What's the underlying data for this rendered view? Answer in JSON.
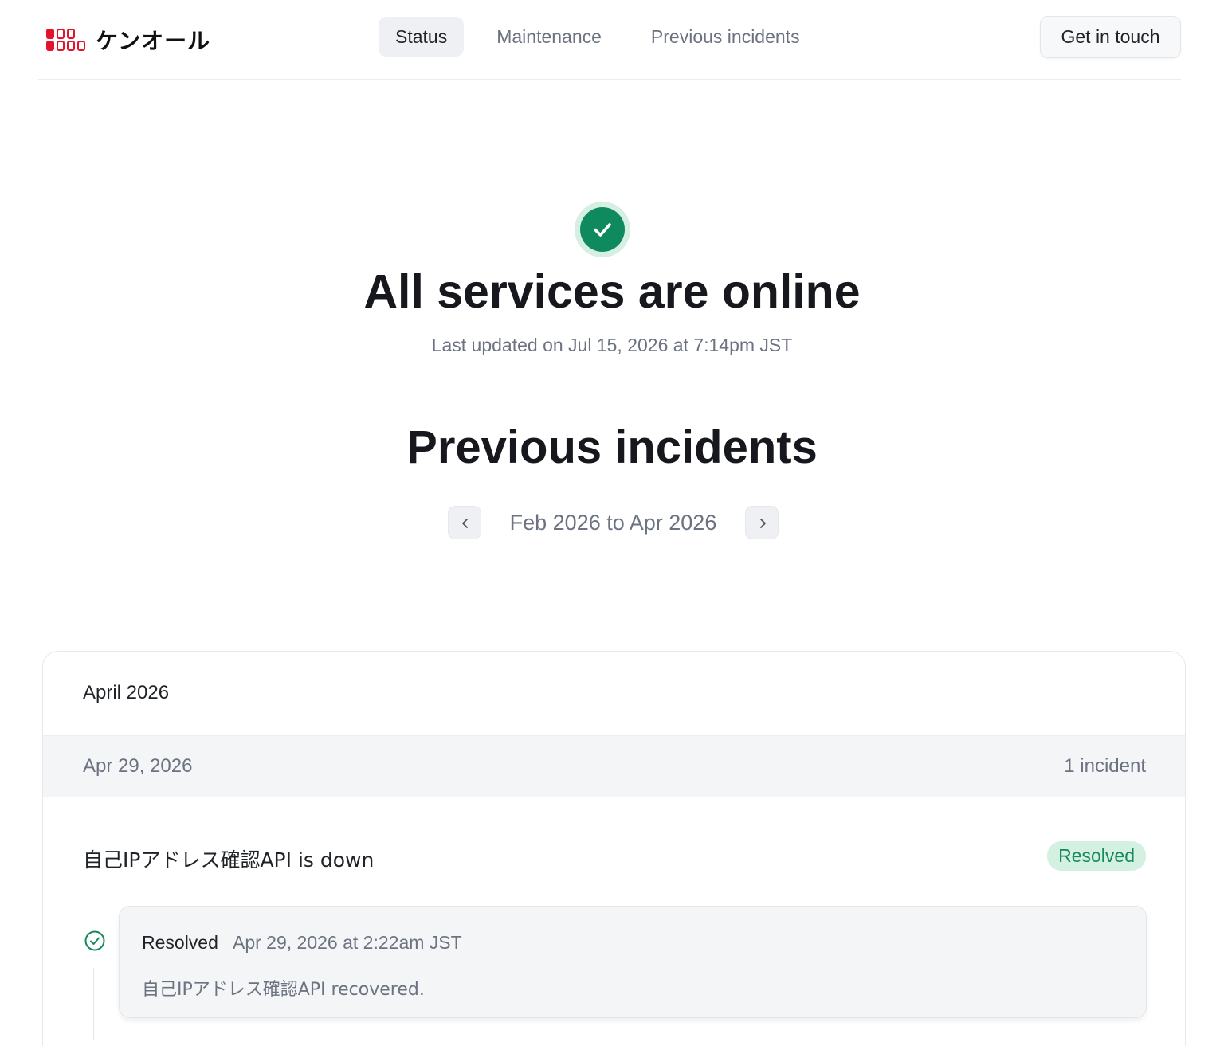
{
  "brand": {
    "name": "ケンオール",
    "accent": "#e4122a"
  },
  "nav": {
    "items": [
      {
        "label": "Status",
        "active": true
      },
      {
        "label": "Maintenance",
        "active": false
      },
      {
        "label": "Previous incidents",
        "active": false
      }
    ],
    "contact_label": "Get in touch"
  },
  "hero": {
    "icon": "check-circle-icon",
    "title": "All services are online",
    "subtitle": "Last updated on Jul 15, 2026 at 7:14pm JST",
    "status_color": "#0f8a5f"
  },
  "incidents": {
    "title": "Previous incidents",
    "range_label": "Feb 2026 to Apr 2026",
    "prev_icon": "chevron-left-icon",
    "next_icon": "chevron-right-icon",
    "months": [
      {
        "label": "April 2026",
        "days": [
          {
            "date": "Apr 29, 2026",
            "count_label": "1 incident",
            "items": [
              {
                "title": "自己IPアドレス確認API is down",
                "status_badge": "Resolved",
                "updates": [
                  {
                    "status": "Resolved",
                    "time": "Apr 29, 2026 at 2:22am JST",
                    "message": "自己IPアドレス確認API recovered."
                  }
                ]
              }
            ]
          }
        ]
      }
    ]
  }
}
